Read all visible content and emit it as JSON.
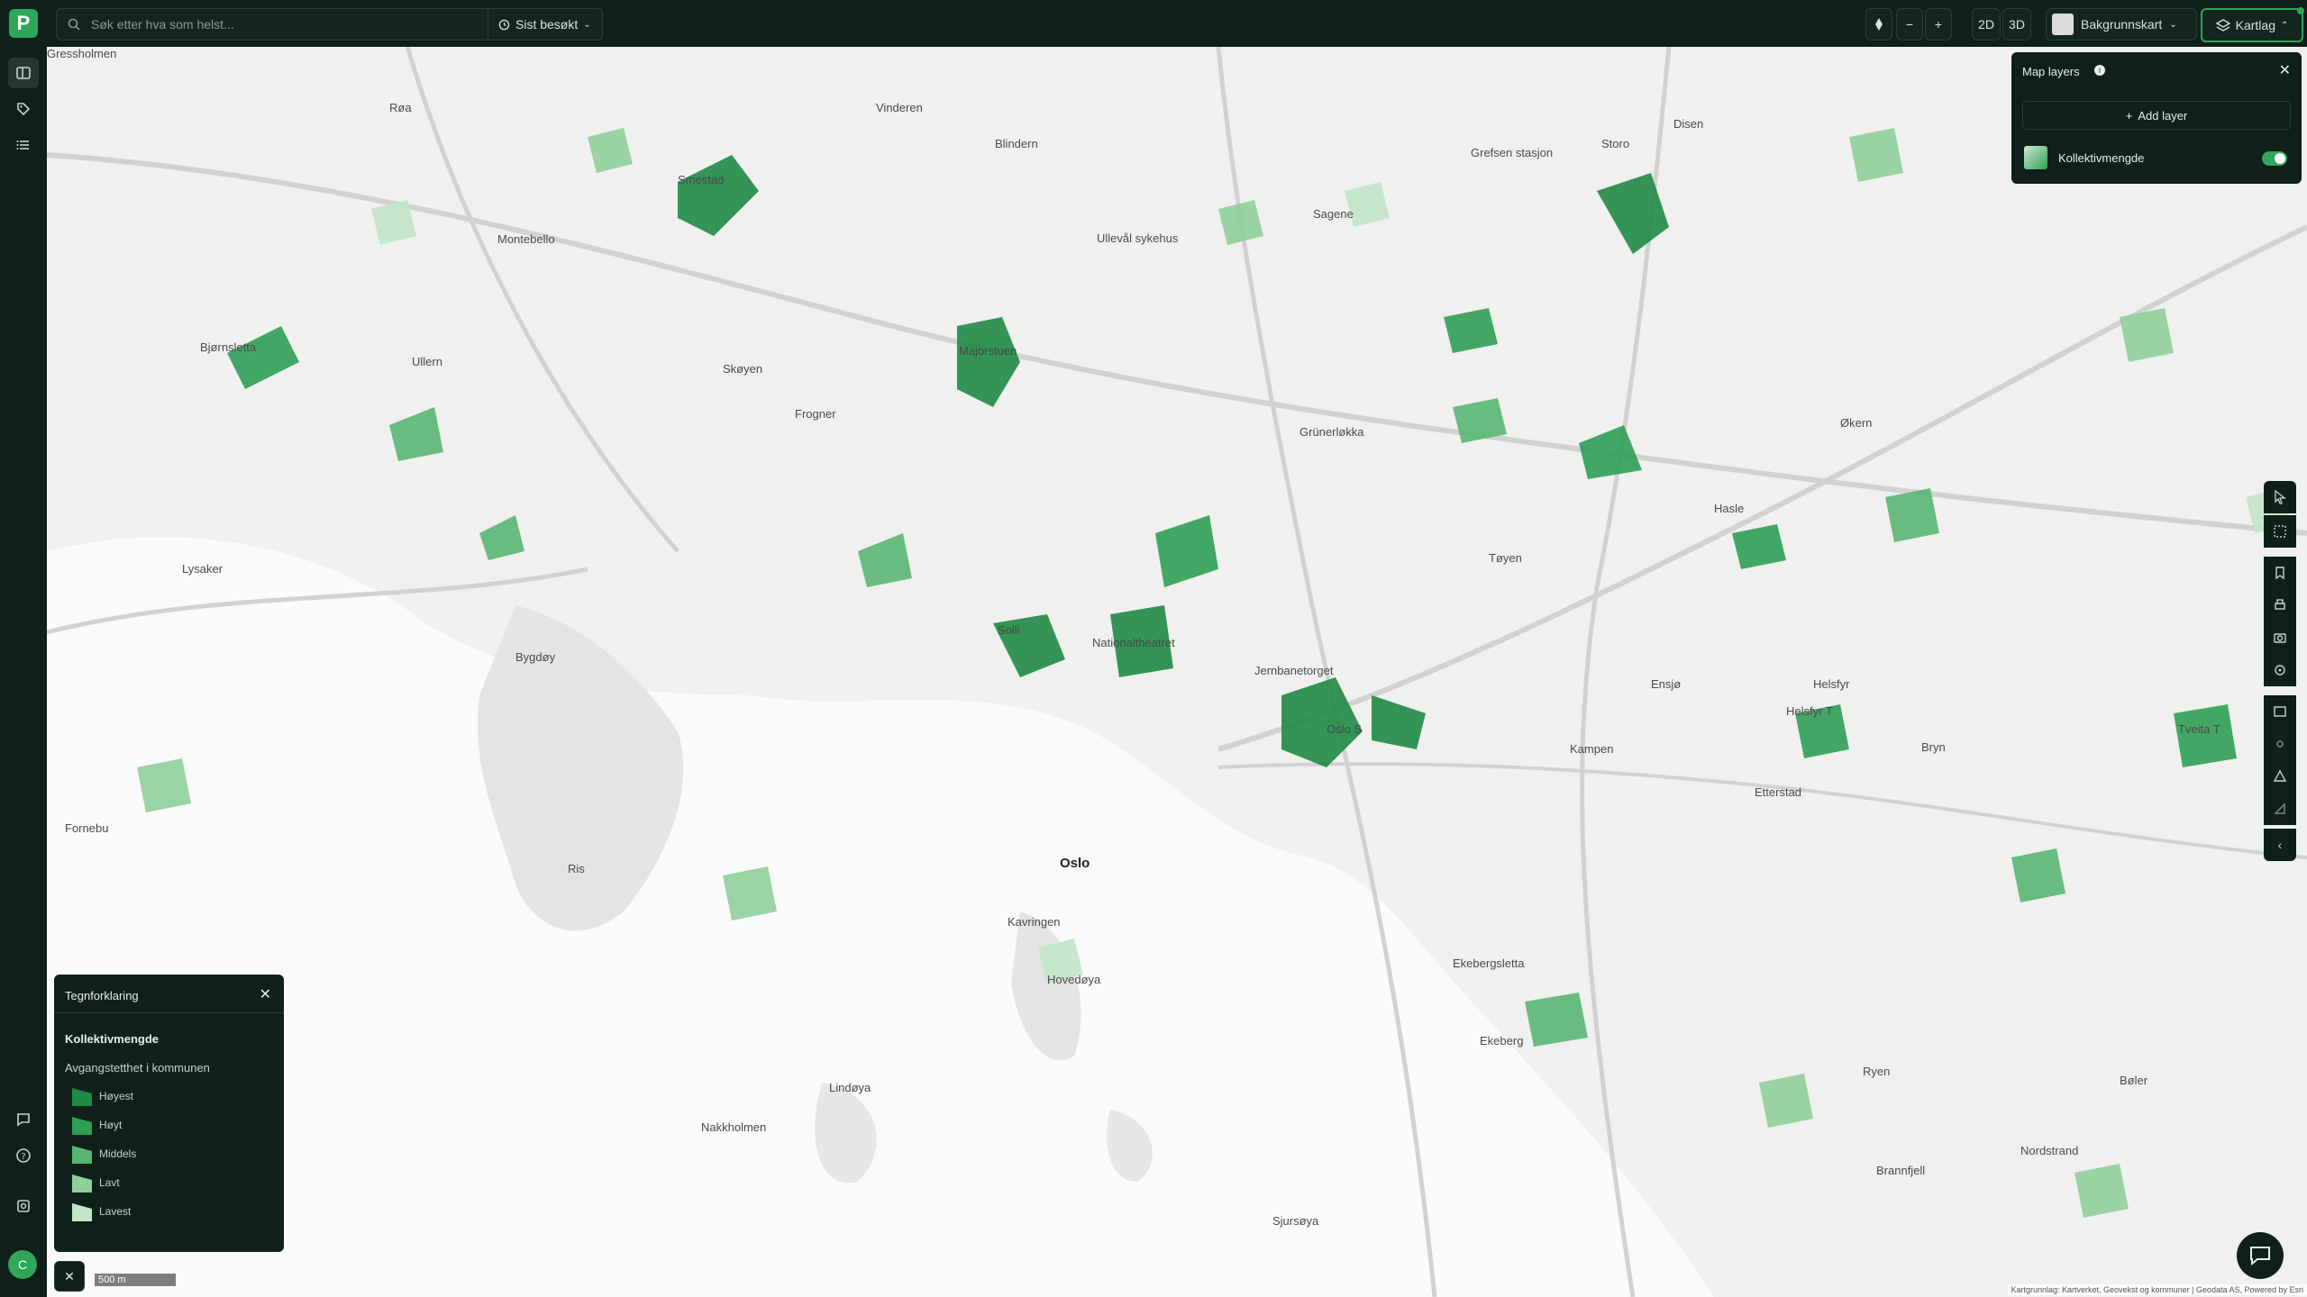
{
  "app": {
    "logo_text": "P",
    "user_initial": "C"
  },
  "search": {
    "placeholder": "Søk etter hva som helst...",
    "recent_label": "Sist besøkt"
  },
  "toolbar": {
    "zoom_out": "−",
    "zoom_in": "+",
    "view_2d": "2D",
    "view_3d": "3D",
    "basemap_label": "Bakgrunnskart",
    "layers_label": "Kartlag"
  },
  "layers_panel": {
    "title": "Map layers",
    "add_layer": "Add layer",
    "layer_name": "Kollektivmengde",
    "layer_enabled": true
  },
  "legend": {
    "title": "Tegnforklaring",
    "layer": "Kollektivmengde",
    "subtitle": "Avgangstetthet i kommunen",
    "items": [
      {
        "label": "Høyest",
        "color": "#1e8a45"
      },
      {
        "label": "Høyt",
        "color": "#2f9e55"
      },
      {
        "label": "Middels",
        "color": "#59b672"
      },
      {
        "label": "Lavt",
        "color": "#8fcf9b"
      },
      {
        "label": "Lavest",
        "color": "#c2e6c8"
      }
    ]
  },
  "map": {
    "city_label": "Oslo",
    "labels": [
      "Smestad",
      "Majorstuen",
      "Grefsen stasjon",
      "Storo",
      "Disen",
      "Hasle",
      "Helsfyr T",
      "Økern",
      "Bjørnsletta",
      "Montebello",
      "Skøyen",
      "Frogner",
      "Solli",
      "Nationaltheatret",
      "Jernbanetorget",
      "Oslo S",
      "Tøyen",
      "Ensjø",
      "Bryn",
      "Ryen",
      "Ekeberg",
      "Nordstrand",
      "Bygdøy",
      "Hovedøya",
      "Lindøya",
      "Nakkholmen",
      "Sjursøya",
      "Kampen",
      "Grünerløkka",
      "Sagene",
      "Ullevål sykehus",
      "Blindern",
      "Røa",
      "Ullern",
      "Vinderen",
      "Ekebergsletta",
      "Brannfjell",
      "Helsfyr",
      "Etterstad",
      "Bøler",
      "Tveita T",
      "Lysaker",
      "Fornebu",
      "Ris",
      "Kavringen",
      "Gressholmen"
    ],
    "scale": "500 m",
    "attribution": "Kartgrunnlag: Kartverket, Geovekst og kommuner | Geodata AS, Powered by Esri"
  }
}
